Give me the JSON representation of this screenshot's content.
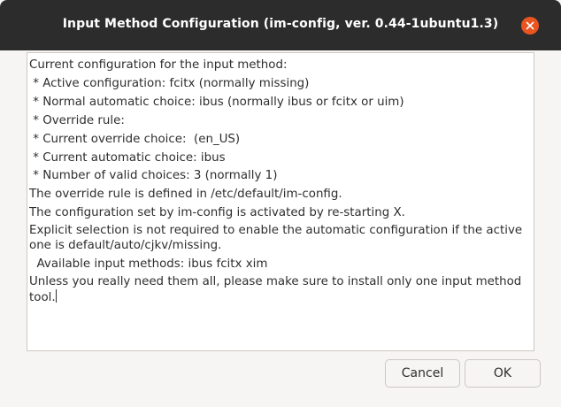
{
  "window": {
    "title": "Input Method Configuration (im-config, ver. 0.44-1ubuntu1.3)"
  },
  "message": {
    "lines": [
      "Current configuration for the input method:",
      " * Active configuration: fcitx (normally missing)",
      " * Normal automatic choice: ibus (normally ibus or fcitx or uim)",
      " * Override rule:",
      " * Current override choice:  (en_US)",
      " * Current automatic choice: ibus",
      " * Number of valid choices: 3 (normally 1)",
      "The override rule is defined in /etc/default/im-config.",
      "The configuration set by im-config is activated by re-starting X.",
      "Explicit selection is not required to enable the automatic configuration if the active one is default/auto/cjkv/missing.",
      "  Available input methods: ibus fcitx xim",
      "Unless you really need them all, please make sure to install only one input method tool."
    ]
  },
  "buttons": {
    "cancel": "Cancel",
    "ok": "OK"
  },
  "colors": {
    "titlebar": "#2c2c2c",
    "close_accent": "#e95420"
  },
  "icons": {
    "close": "close-icon"
  }
}
